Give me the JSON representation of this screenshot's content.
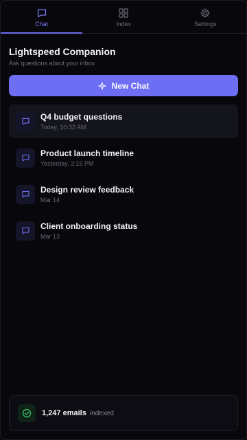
{
  "tabs": [
    {
      "label": "Chat",
      "icon": "chat-bubble-icon",
      "active": true
    },
    {
      "label": "Index",
      "icon": "grid-icon",
      "active": false
    },
    {
      "label": "Settings",
      "icon": "gear-icon",
      "active": false
    }
  ],
  "header": {
    "title": "Lightspeed Companion",
    "subtitle": "Ask questions about your inbox"
  },
  "new_chat": {
    "label": "New Chat",
    "icon": "sparkle-icon"
  },
  "chats": [
    {
      "title": "Q4 budget questions",
      "time": "Today, 10:32 AM",
      "selected": true
    },
    {
      "title": "Product launch timeline",
      "time": "Yesterday, 3:15 PM",
      "selected": false
    },
    {
      "title": "Design review feedback",
      "time": "Mar 14",
      "selected": false
    },
    {
      "title": "Client onboarding status",
      "time": "Mar 13",
      "selected": false
    }
  ],
  "footer": {
    "count": "1,247 emails",
    "suffix": "indexed",
    "icon": "check-circle-icon"
  },
  "colors": {
    "accent": "#6e6ef5",
    "background": "#08080c",
    "success": "#3fbf6a"
  }
}
